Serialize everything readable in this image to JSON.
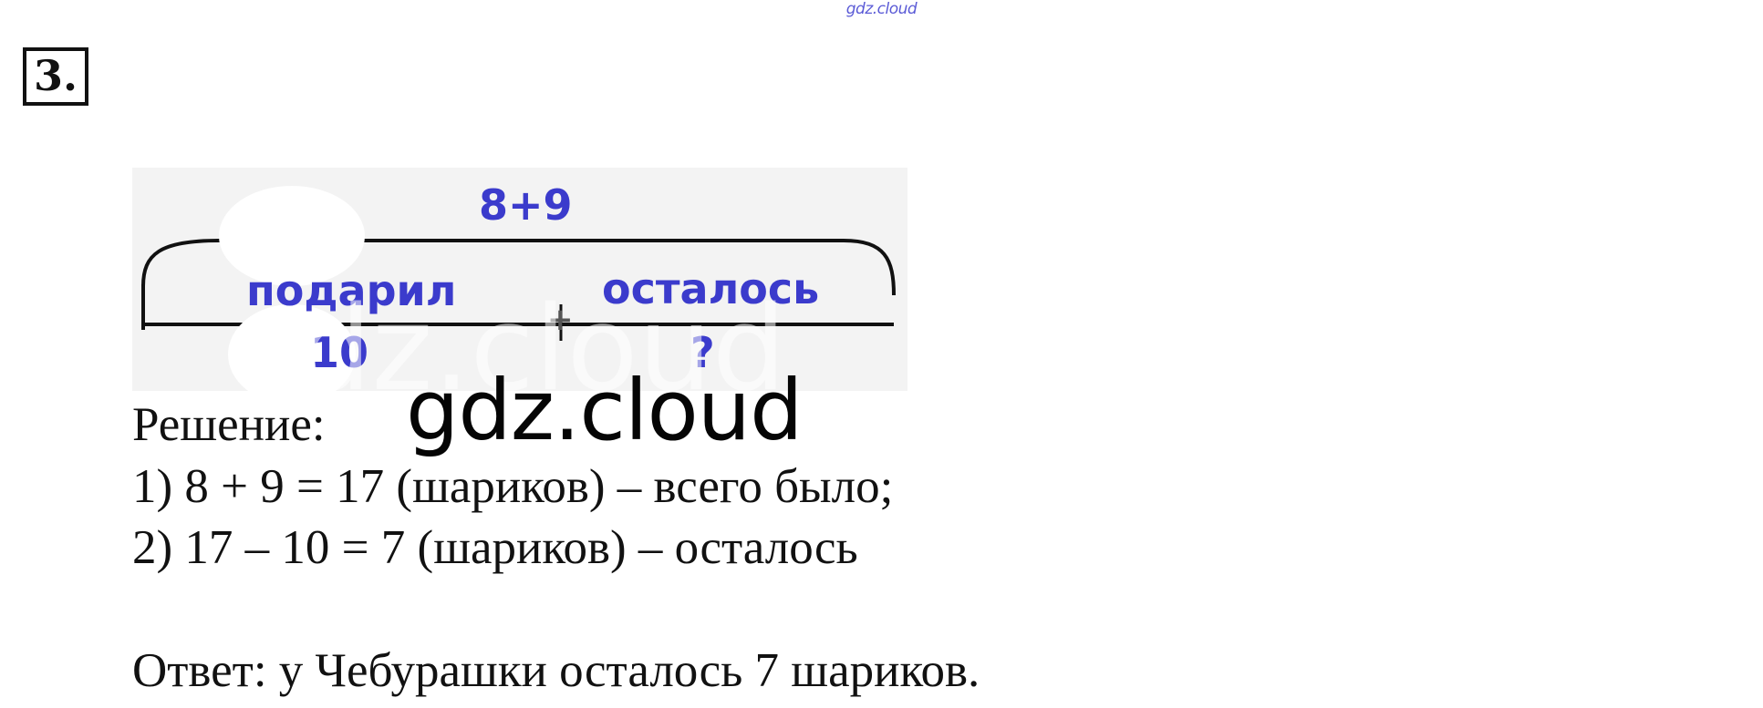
{
  "watermark_top": "gdz.cloud",
  "task": {
    "number": "3."
  },
  "scheme": {
    "total_label": "8+9",
    "part1_label": "подарил",
    "part2_label": "осталось",
    "part1_value": "10",
    "part2_value": "?",
    "operator": "+"
  },
  "watermark_big": "gdz.cloud",
  "solution": {
    "heading": "Решение:",
    "steps": [
      "1)  8 + 9 = 17 (шариков) – всего было;",
      "2)  17 – 10 = 7 (шариков) – осталось"
    ],
    "answer": "Ответ: у Чебурашки осталось 7 шариков."
  }
}
